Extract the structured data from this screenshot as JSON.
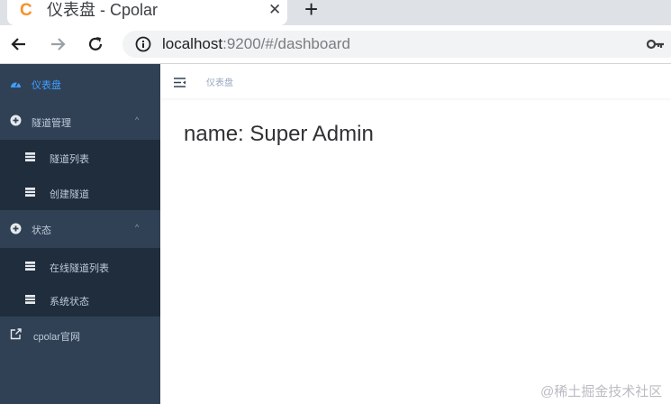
{
  "browser": {
    "tab": {
      "favicon": "C",
      "title": "仪表盘 - Cpolar",
      "close": "✕"
    },
    "new_tab": "+",
    "url_host": "localhost",
    "url_rest": ":9200/#/dashboard",
    "icons": [
      "back-icon",
      "forward-icon",
      "reload-icon",
      "info-icon",
      "key-icon"
    ]
  },
  "sidebar": {
    "items": [
      {
        "label": "仪表盘",
        "icon": "dashboard-icon",
        "active": true
      },
      {
        "label": "隧道管理",
        "icon": "plus-circle-icon",
        "chevron": "^"
      },
      {
        "label": "隧道列表",
        "icon": "list-icon"
      },
      {
        "label": "创建隧道",
        "icon": "list-icon"
      },
      {
        "label": "状态",
        "icon": "plus-circle-icon",
        "chevron": "^"
      },
      {
        "label": "在线隧道列表",
        "icon": "list-icon"
      },
      {
        "label": "系统状态",
        "icon": "list-icon"
      },
      {
        "label": "cpolar官网",
        "icon": "external-link-icon"
      }
    ]
  },
  "main": {
    "breadcrumb": "仪表盘",
    "dashboard_text": "name: Super Admin"
  },
  "watermark": "@稀土掘金技术社区",
  "colors": {
    "sidebar_bg": "#304156",
    "submenu_bg": "#1f2d3d",
    "active": "#409eff",
    "favicon": "#f7912a"
  }
}
